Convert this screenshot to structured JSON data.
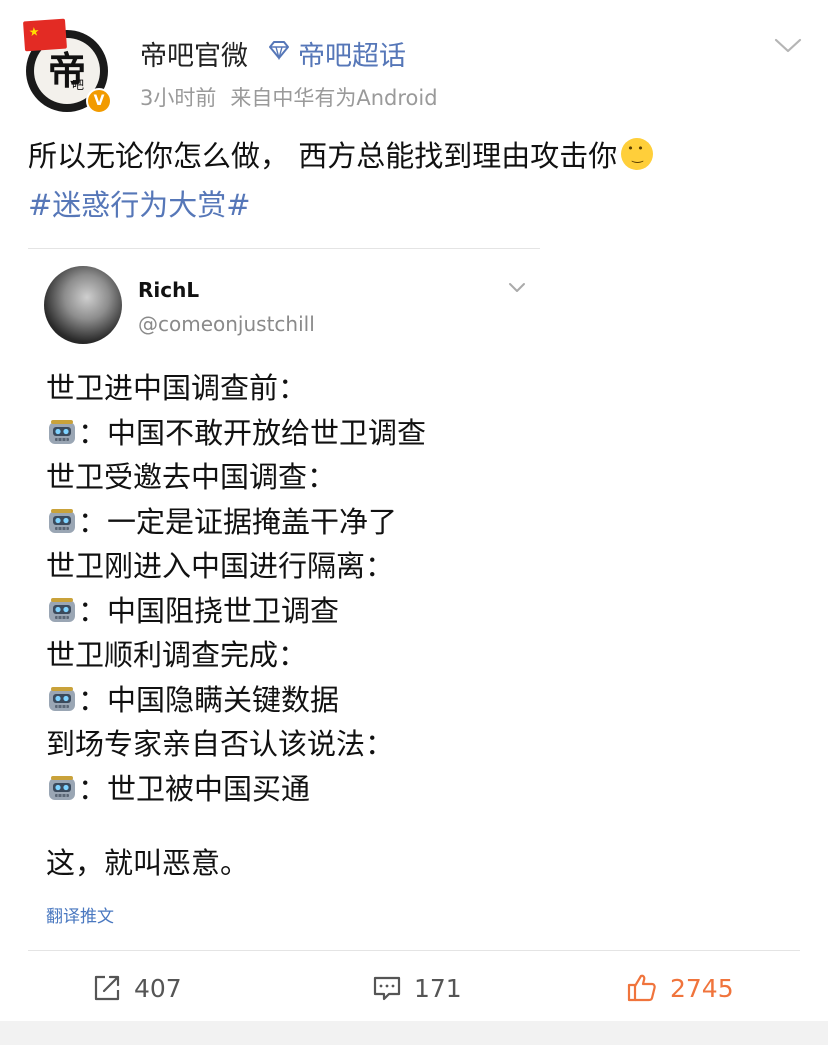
{
  "post": {
    "author": "帝吧官微",
    "super_topic": "帝吧超话",
    "time": "3小时前",
    "source": "来自中华有为Android",
    "avatar_text": "帝",
    "avatar_sub": "吧",
    "text": "所以无论你怎么做， 西方总能找到理由攻击你",
    "hashtag": "#迷惑行为大赏#"
  },
  "tweet": {
    "name": "RichL",
    "handle": "@comeonjustchill",
    "lines": [
      {
        "text": "世卫进中国调查前：",
        "robot": false
      },
      {
        "text": "：中国不敢开放给世卫调查",
        "robot": true
      },
      {
        "text": "世卫受邀去中国调查：",
        "robot": false
      },
      {
        "text": "：一定是证据掩盖干净了",
        "robot": true
      },
      {
        "text": "世卫刚进入中国进行隔离：",
        "robot": false
      },
      {
        "text": "：中国阻挠世卫调查",
        "robot": true
      },
      {
        "text": "世卫顺利调查完成：",
        "robot": false
      },
      {
        "text": "：中国隐瞒关键数据",
        "robot": true
      },
      {
        "text": "到场专家亲自否认该说法：",
        "robot": false
      },
      {
        "text": "：世卫被中国买通",
        "robot": true
      }
    ],
    "closing": "这，就叫恶意。",
    "translate_label": "翻译推文"
  },
  "actions": {
    "repost_count": "407",
    "comment_count": "171",
    "like_count": "2745"
  },
  "colors": {
    "link_blue": "#5677b8",
    "like_orange": "#f0743c",
    "meta_gray": "#9a9a9a"
  },
  "icons": {
    "verify": "verified-badge-icon",
    "topic": "super-topic-gem-icon",
    "menu": "chevron-down-icon",
    "repost": "repost-icon",
    "comment": "comment-icon",
    "like": "thumbs-up-icon",
    "robot": "robot-emoji-icon",
    "shrug": "shrug-emoji-icon"
  }
}
